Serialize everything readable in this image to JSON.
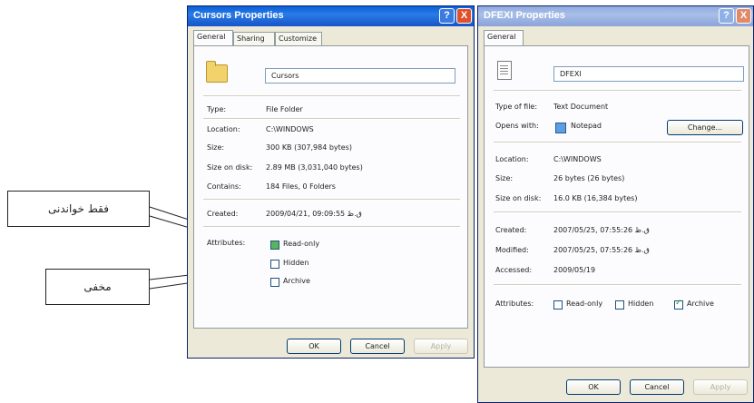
{
  "cursors": {
    "title": "Cursors Properties",
    "help": "?",
    "close": "X",
    "tabs": [
      "General",
      "Sharing",
      "Customize"
    ],
    "name": "Cursors",
    "type_label": "Type:",
    "type_value": "File Folder",
    "location_label": "Location:",
    "location_value": "C:\\WINDOWS",
    "size_label": "Size:",
    "size_value": "300 KB (307,984 bytes)",
    "sizeondisk_label": "Size on disk:",
    "sizeondisk_value": "2.89 MB (3,031,040 bytes)",
    "contains_label": "Contains:",
    "contains_value": "184 Files, 0 Folders",
    "created_label": "Created:",
    "created_value": "2009/04/21, 09:09:55 ق.ظ",
    "attributes_label": "Attributes:",
    "readonly": "Read-only",
    "hidden": "Hidden",
    "archive": "Archive",
    "ok": "OK",
    "cancel": "Cancel",
    "apply": "Apply"
  },
  "dfexi": {
    "title": "DFEXI Properties",
    "help": "?",
    "close": "X",
    "tab": "General",
    "name": "DFEXI",
    "typeoffile_label": "Type of file:",
    "typeoffile_value": "Text Document",
    "openswith_label": "Opens with:",
    "openswith_value": "Notepad",
    "change": "Change...",
    "location_label": "Location:",
    "location_value": "C:\\WINDOWS",
    "size_label": "Size:",
    "size_value": "26 bytes (26 bytes)",
    "sizeondisk_label": "Size on disk:",
    "sizeondisk_value": "16.0 KB (16,384 bytes)",
    "created_label": "Created:",
    "created_value": "2007/05/25, 07:55:26 ق.ظ",
    "modified_label": "Modified:",
    "modified_value": "2007/05/25, 07:55:26 ق.ظ",
    "accessed_label": "Accessed:",
    "accessed_value": "2009/05/19",
    "attributes_label": "Attributes:",
    "readonly": "Read-only",
    "hidden": "Hidden",
    "archive": "Archive",
    "ok": "OK",
    "cancel": "Cancel",
    "apply": "Apply"
  },
  "callouts": {
    "readonly": "فقط خواندنی",
    "hidden": "مخفی"
  }
}
